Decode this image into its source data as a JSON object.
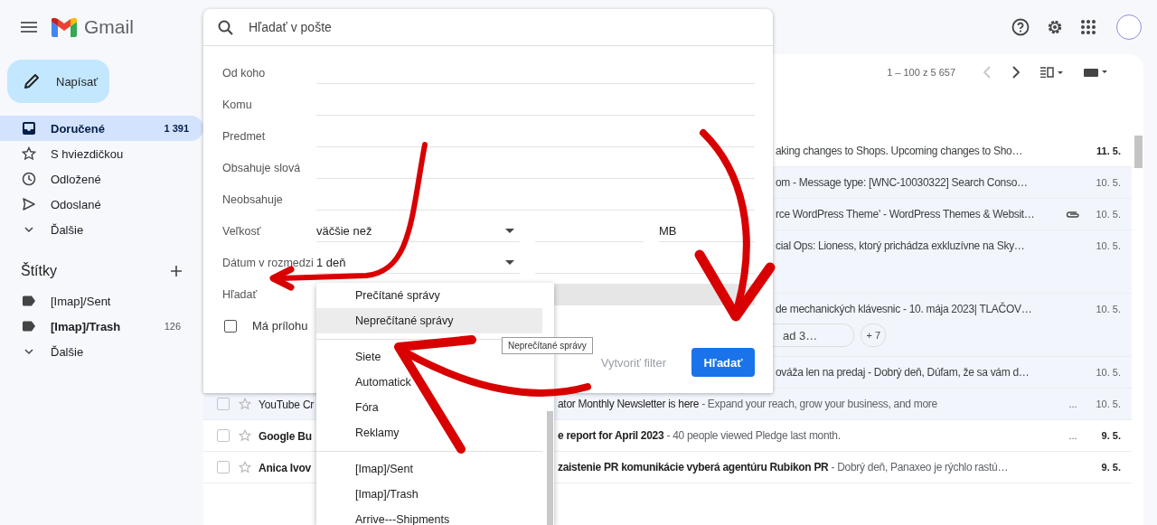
{
  "app": {
    "logo": "Gmail"
  },
  "search": {
    "placeholder": "Hľadať v pošte"
  },
  "compose": {
    "label": "Napísať"
  },
  "sidebar": {
    "items": [
      {
        "kind": "inbox",
        "label": "Doručené",
        "count": "1 391",
        "selected": true
      },
      {
        "kind": "star",
        "label": "S hviezdičkou",
        "selected": false
      },
      {
        "kind": "clock",
        "label": "Odložené",
        "selected": false
      },
      {
        "kind": "send",
        "label": "Odoslané",
        "selected": false
      },
      {
        "kind": "more",
        "label": "Ďalšie",
        "selected": false
      }
    ],
    "labels_title": "Štítky",
    "labels": [
      {
        "kind": "label",
        "label": "[Imap]/Sent",
        "bold": false
      },
      {
        "kind": "label",
        "label": "[Imap]/Trash",
        "count": "126",
        "bold": true
      },
      {
        "kind": "more",
        "label": "Ďalšie",
        "bold": false
      }
    ]
  },
  "toolbar": {
    "range": "1 – 100 z 5 657"
  },
  "messages": [
    {
      "kind": "covered",
      "read": false,
      "snippet": "aking changes to Shops. Upcoming changes to Sho…",
      "date": "11. 5."
    },
    {
      "kind": "covered",
      "read": true,
      "snippet": "om - Message type: [WNC-10030322] Search Conso…",
      "date": "10. 5."
    },
    {
      "kind": "covered",
      "read": true,
      "snippet": "rce WordPress Theme' - WordPress Themes & Websit…",
      "attachment": true,
      "date": "10. 5."
    },
    {
      "kind": "covered",
      "read": true,
      "tall": true,
      "snippet": "cial Ops: Lioness, ktorý prichádza exkluzívne na Sky…",
      "date": "10. 5."
    },
    {
      "kind": "covered",
      "read": true,
      "tall": true,
      "snippet": "de mechanických klávesnic - 10. mája 2023| TLAČOV…",
      "chips": [
        "ad 3…",
        "+ 7"
      ],
      "date": "10. 5."
    },
    {
      "kind": "covered",
      "read": true,
      "snippet": "ováža len na predaj - Dobrý deň, Dúfam, že sa vám d…",
      "date": "10. 5."
    },
    {
      "kind": "full",
      "read": true,
      "sender": "YouTube Cr",
      "subject": "ator Monthly Newsletter is here",
      "snippet": " - Expand your reach, grow your business, and more",
      "extra": "...",
      "date": "10. 5."
    },
    {
      "kind": "full",
      "read": false,
      "sender": "Google Bu",
      "subject": "e report for April 2023",
      "snippet": " - 40 people viewed Pledge last month.",
      "extra": "...",
      "date": "9. 5."
    },
    {
      "kind": "full",
      "read": false,
      "sender": "Anica Ivov",
      "subject": "zaistenie PR komunikácie vyberá agentúru Rubikon PR",
      "snippet": " - Dobrý deň, Panaxeo je rýchlo rastú…",
      "date": "9. 5."
    }
  ],
  "dialog": {
    "fields": [
      {
        "kind": "text",
        "label": "Od koho"
      },
      {
        "kind": "text",
        "label": "Komu"
      },
      {
        "kind": "text",
        "label": "Predmet"
      },
      {
        "kind": "text",
        "label": "Obsahuje slová"
      },
      {
        "kind": "text",
        "label": "Neobsahuje"
      },
      {
        "kind": "size",
        "label": "Veľkosť",
        "operator": "väčšie než",
        "unit": "MB"
      },
      {
        "kind": "date",
        "label": "Dátum v rozmedzi",
        "value": "1 deň"
      },
      {
        "kind": "select",
        "label": "Hľadať"
      }
    ],
    "attachment": {
      "label": "Má prílohu",
      "checked": false
    },
    "filter_button": "Vytvoriť filter",
    "search_button": "Hľadať"
  },
  "dropdown": {
    "groups": [
      [
        {
          "label": "Prečítané správy",
          "selected": false
        },
        {
          "label": "Neprečítané správy",
          "selected": true
        }
      ],
      [
        {
          "label": "Siete",
          "selected": false
        },
        {
          "label": "Automatick",
          "selected": false
        },
        {
          "label": "Fóra",
          "selected": false
        },
        {
          "label": "Reklamy",
          "selected": false
        }
      ],
      [
        {
          "label": "[Imap]/Sent",
          "selected": false
        },
        {
          "label": "[Imap]/Trash",
          "selected": false
        },
        {
          "label": "Arrive---Shipments",
          "selected": false
        }
      ]
    ],
    "tooltip": "Neprečítané správy"
  }
}
